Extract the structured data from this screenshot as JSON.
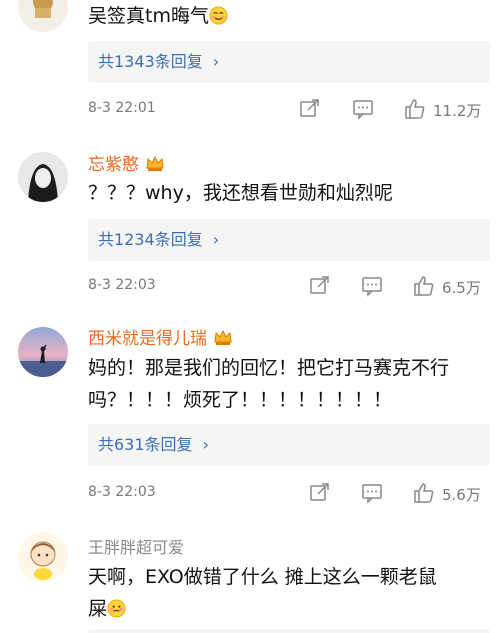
{
  "comments": [
    {
      "name": "",
      "text": "吴签真tm晦气",
      "replies": "共1343条回复",
      "time": "8-3 22:01",
      "likes": "11.2万"
    },
    {
      "name": "忘紫憨",
      "text": "？？？why，我还想看世勋和灿烈呢",
      "replies": "共1234条回复",
      "time": "8-3 22:03",
      "likes": "6.5万"
    },
    {
      "name": "西米就是得儿瑞",
      "text_line1": "妈的！那是我们的回忆！把它打马赛克不行",
      "text_line2": "吗？！！！烦死了！！！！！！！！",
      "replies": "共631条回复",
      "time": "8-3 22:03",
      "likes": "5.6万"
    },
    {
      "name": "王胖胖超可爱",
      "text_line1": "天啊，EXO做错了什么 摊上这么一颗老鼠",
      "text_line2": "屎"
    }
  ],
  "icons": {
    "share": "share-icon",
    "comment": "comment-icon",
    "like": "thumbs-up-icon",
    "chevron": "chevron-right-icon",
    "crown": "vip-crown-icon",
    "smile": "smile-emoji-icon",
    "shy": "shy-emoji-icon"
  },
  "colors": {
    "username": "#e86b1f",
    "reply_link": "#3b6fb6",
    "reply_bg": "#f5f5f5"
  }
}
